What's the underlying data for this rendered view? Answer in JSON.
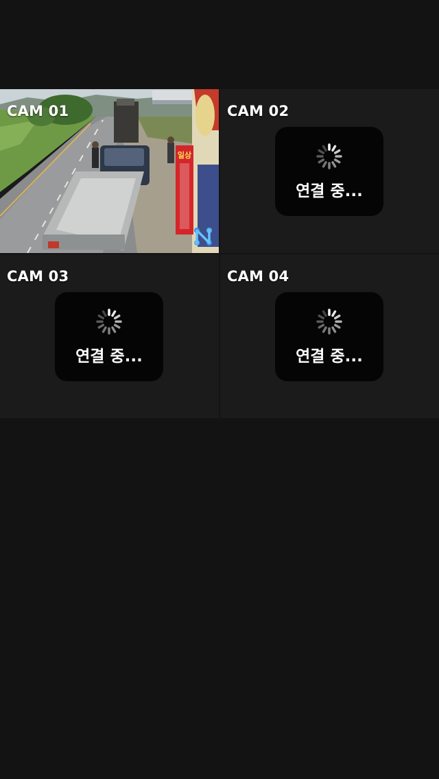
{
  "cameras": [
    {
      "label": "CAM 01",
      "status": "live"
    },
    {
      "label": "CAM 02",
      "status": "connecting",
      "status_text": "연결 중..."
    },
    {
      "label": "CAM 03",
      "status": "connecting",
      "status_text": "연결 중..."
    },
    {
      "label": "CAM 04",
      "status": "connecting",
      "status_text": "연결 중..."
    }
  ],
  "feed1": {
    "banner_text": "일상"
  },
  "icons": {
    "spinner": "spinner-icon",
    "overlay": "network-logo-icon"
  },
  "colors": {
    "background": "#131313",
    "cell_background": "#1b1b1b",
    "loading_box": "#050505",
    "label_text": "#ffffff"
  }
}
